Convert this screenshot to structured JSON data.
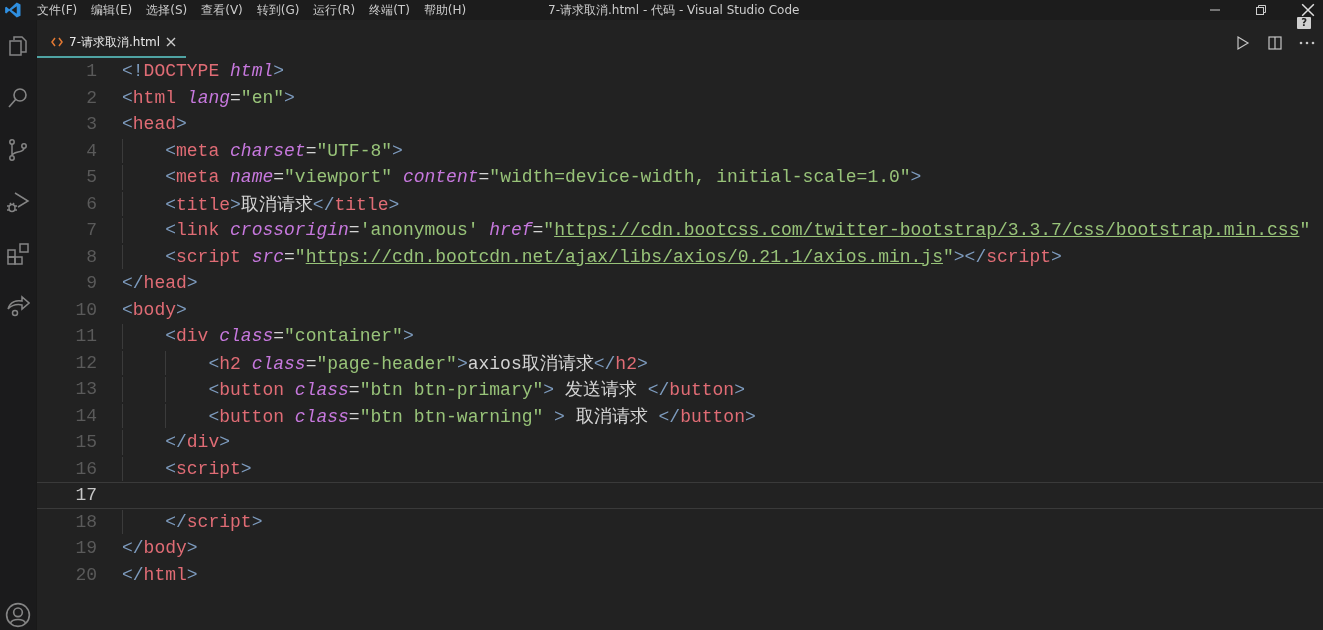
{
  "window": {
    "title": "7-请求取消.html - 代码 - Visual Studio Code"
  },
  "menu": [
    "文件(F)",
    "编辑(E)",
    "选择(S)",
    "查看(V)",
    "转到(G)",
    "运行(R)",
    "终端(T)",
    "帮助(H)"
  ],
  "tabs": [
    {
      "label": "7-请求取消.html",
      "selected": true
    }
  ],
  "help_badge": "?",
  "editor": {
    "lines": [
      {
        "number": "1",
        "current": false,
        "tokens": [
          {
            "kind": "p",
            "text": "<!"
          },
          {
            "kind": "tag",
            "text": "DOCTYPE"
          },
          {
            "kind": "attr",
            "text": " html"
          },
          {
            "kind": "p",
            "text": ">"
          }
        ]
      },
      {
        "number": "2",
        "current": false,
        "tokens": [
          {
            "kind": "p",
            "text": "<"
          },
          {
            "kind": "tag",
            "text": "html"
          },
          {
            "kind": "attr",
            "text": " lang"
          },
          {
            "kind": "text",
            "text": "="
          },
          {
            "kind": "str",
            "text": "\"en\""
          },
          {
            "kind": "p",
            "text": ">"
          }
        ]
      },
      {
        "number": "3",
        "current": false,
        "tokens": [
          {
            "kind": "p",
            "text": "<"
          },
          {
            "kind": "tag",
            "text": "head"
          },
          {
            "kind": "p",
            "text": ">"
          }
        ],
        "children": [
          {
            "number": "4",
            "current": false,
            "tokens": [
              {
                "kind": "p",
                "text": "<"
              },
              {
                "kind": "tag",
                "text": "meta"
              },
              {
                "kind": "attr",
                "text": " charset"
              },
              {
                "kind": "text",
                "text": "="
              },
              {
                "kind": "str",
                "text": "\"UTF-8\""
              },
              {
                "kind": "p",
                "text": ">"
              }
            ]
          },
          {
            "number": "5",
            "current": false,
            "tokens": [
              {
                "kind": "p",
                "text": "<"
              },
              {
                "kind": "tag",
                "text": "meta"
              },
              {
                "kind": "attr",
                "text": " name"
              },
              {
                "kind": "text",
                "text": "="
              },
              {
                "kind": "str",
                "text": "\"viewport\""
              },
              {
                "kind": "attr",
                "text": " content"
              },
              {
                "kind": "text",
                "text": "="
              },
              {
                "kind": "str",
                "text": "\"width=device-width, initial-scale=1.0\""
              },
              {
                "kind": "p",
                "text": ">"
              }
            ]
          },
          {
            "number": "6",
            "current": false,
            "tokens": [
              {
                "kind": "p",
                "text": "<"
              },
              {
                "kind": "tag",
                "text": "title"
              },
              {
                "kind": "p",
                "text": ">"
              },
              {
                "kind": "text",
                "text": "取消请求"
              },
              {
                "kind": "p",
                "text": "</"
              },
              {
                "kind": "tag",
                "text": "title"
              },
              {
                "kind": "p",
                "text": ">"
              }
            ]
          },
          {
            "number": "7",
            "current": false,
            "tokens": [
              {
                "kind": "p",
                "text": "<"
              },
              {
                "kind": "tag",
                "text": "link"
              },
              {
                "kind": "attr",
                "text": " crossorigin"
              },
              {
                "kind": "text",
                "text": "="
              },
              {
                "kind": "str",
                "text": "'anonymous'"
              },
              {
                "kind": "attr",
                "text": " href"
              },
              {
                "kind": "text",
                "text": "="
              },
              {
                "kind": "str",
                "text": "\""
              },
              {
                "kind": "url",
                "text": "https://cdn.bootcss.com/twitter-bootstrap/3.3.7/css/bootstrap.min.css"
              },
              {
                "kind": "str",
                "text": "\""
              }
            ]
          },
          {
            "number": "8",
            "current": false,
            "tokens": [
              {
                "kind": "p",
                "text": "<"
              },
              {
                "kind": "tag",
                "text": "script"
              },
              {
                "kind": "attr",
                "text": " src"
              },
              {
                "kind": "text",
                "text": "="
              },
              {
                "kind": "str",
                "text": "\""
              },
              {
                "kind": "url",
                "text": "https://cdn.bootcdn.net/ajax/libs/axios/0.21.1/axios.min.js"
              },
              {
                "kind": "str",
                "text": "\""
              },
              {
                "kind": "p",
                "text": "></"
              },
              {
                "kind": "tag",
                "text": "script"
              },
              {
                "kind": "p",
                "text": ">"
              }
            ]
          }
        ]
      },
      {
        "number": "9",
        "current": false,
        "tokens": [
          {
            "kind": "p",
            "text": "</"
          },
          {
            "kind": "tag",
            "text": "head"
          },
          {
            "kind": "p",
            "text": ">"
          }
        ]
      },
      {
        "number": "10",
        "current": false,
        "tokens": [
          {
            "kind": "p",
            "text": "<"
          },
          {
            "kind": "tag",
            "text": "body"
          },
          {
            "kind": "p",
            "text": ">"
          }
        ],
        "children": [
          {
            "number": "11",
            "current": false,
            "tokens": [
              {
                "kind": "p",
                "text": "<"
              },
              {
                "kind": "tag",
                "text": "div"
              },
              {
                "kind": "attr",
                "text": " class"
              },
              {
                "kind": "text",
                "text": "="
              },
              {
                "kind": "str",
                "text": "\"container\""
              },
              {
                "kind": "p",
                "text": ">"
              }
            ],
            "children": [
              {
                "number": "12",
                "current": false,
                "tokens": [
                  {
                    "kind": "p",
                    "text": "<"
                  },
                  {
                    "kind": "tag",
                    "text": "h2"
                  },
                  {
                    "kind": "attr",
                    "text": " class"
                  },
                  {
                    "kind": "text",
                    "text": "="
                  },
                  {
                    "kind": "str",
                    "text": "\"page-header\""
                  },
                  {
                    "kind": "p",
                    "text": ">"
                  },
                  {
                    "kind": "text",
                    "text": "axios取消请求"
                  },
                  {
                    "kind": "p",
                    "text": "</"
                  },
                  {
                    "kind": "tag",
                    "text": "h2"
                  },
                  {
                    "kind": "p",
                    "text": ">"
                  }
                ]
              },
              {
                "number": "13",
                "current": false,
                "tokens": [
                  {
                    "kind": "p",
                    "text": "<"
                  },
                  {
                    "kind": "tag",
                    "text": "button"
                  },
                  {
                    "kind": "attr",
                    "text": " class"
                  },
                  {
                    "kind": "text",
                    "text": "="
                  },
                  {
                    "kind": "str",
                    "text": "\"btn btn-primary\""
                  },
                  {
                    "kind": "p",
                    "text": ">"
                  },
                  {
                    "kind": "text",
                    "text": " 发送请求 "
                  },
                  {
                    "kind": "p",
                    "text": "</"
                  },
                  {
                    "kind": "tag",
                    "text": "button"
                  },
                  {
                    "kind": "p",
                    "text": ">"
                  }
                ]
              },
              {
                "number": "14",
                "current": false,
                "tokens": [
                  {
                    "kind": "p",
                    "text": "<"
                  },
                  {
                    "kind": "tag",
                    "text": "button"
                  },
                  {
                    "kind": "attr",
                    "text": " class"
                  },
                  {
                    "kind": "text",
                    "text": "="
                  },
                  {
                    "kind": "str",
                    "text": "\"btn btn-warning\""
                  },
                  {
                    "kind": "p",
                    "text": " >"
                  },
                  {
                    "kind": "text",
                    "text": " 取消请求 "
                  },
                  {
                    "kind": "p",
                    "text": "</"
                  },
                  {
                    "kind": "tag",
                    "text": "button"
                  },
                  {
                    "kind": "p",
                    "text": ">"
                  }
                ]
              }
            ]
          },
          {
            "number": "15",
            "current": false,
            "tokens": [
              {
                "kind": "p",
                "text": "</"
              },
              {
                "kind": "tag",
                "text": "div"
              },
              {
                "kind": "p",
                "text": ">"
              }
            ]
          },
          {
            "number": "16",
            "current": false,
            "tokens": [
              {
                "kind": "p",
                "text": "<"
              },
              {
                "kind": "tag",
                "text": "script"
              },
              {
                "kind": "p",
                "text": ">"
              }
            ],
            "children": [
              {
                "number": "17",
                "current": true
              }
            ]
          },
          {
            "number": "18",
            "current": false,
            "tokens": [
              {
                "kind": "p",
                "text": "</"
              },
              {
                "kind": "tag",
                "text": "script"
              },
              {
                "kind": "p",
                "text": ">"
              }
            ]
          }
        ]
      },
      {
        "number": "19",
        "current": false,
        "tokens": [
          {
            "kind": "p",
            "text": "</"
          },
          {
            "kind": "tag",
            "text": "body"
          },
          {
            "kind": "p",
            "text": ">"
          }
        ]
      },
      {
        "number": "20",
        "current": false,
        "tokens": [
          {
            "kind": "p",
            "text": "</"
          },
          {
            "kind": "tag",
            "text": "html"
          },
          {
            "kind": "p",
            "text": ">"
          }
        ]
      }
    ]
  }
}
